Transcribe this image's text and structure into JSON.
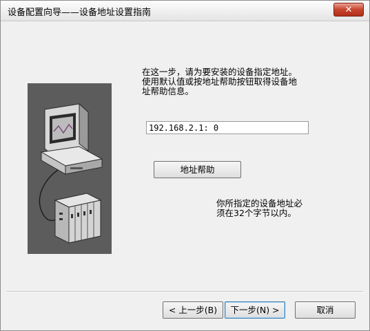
{
  "window": {
    "title": "设备配置向导——设备地址设置指南",
    "close_glyph": "✕"
  },
  "content": {
    "instruction_line1": "在这一步，请为要安装的设备指定地址。",
    "instruction_line2": "使用默认值或按地址帮助按钮取得设备地",
    "instruction_line3": "址帮助信息。",
    "address_value": "192.168.2.1: 0",
    "help_button_label": "地址帮助",
    "note_line1": "你所指定的设备地址必",
    "note_line2": "须在32个字节以内。"
  },
  "footer": {
    "back_label": "< 上一步(B)",
    "next_label": "下一步(N) >",
    "cancel_label": "取消"
  },
  "illustration": {
    "icon": "computer-connected-to-device-icon",
    "background_color": "#5c5c5c"
  }
}
